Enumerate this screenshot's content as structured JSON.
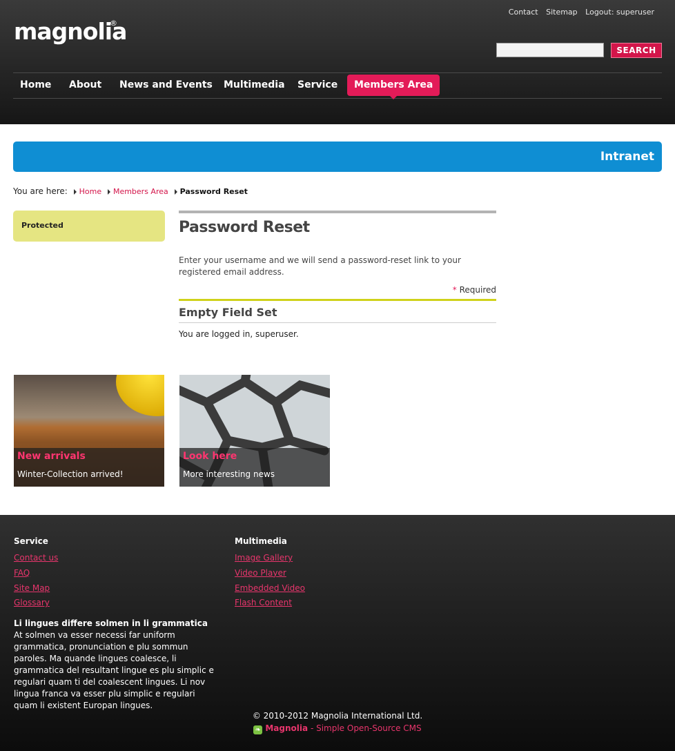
{
  "header": {
    "logo_text": "magnolia",
    "logo_reg": "®",
    "top_links": [
      "Contact",
      "Sitemap",
      "Logout: superuser"
    ],
    "search_value": "",
    "search_button": "SEARCH"
  },
  "nav": {
    "items": [
      "Home",
      "About",
      "News and Events",
      "Multimedia",
      "Service",
      "Members Area"
    ],
    "active": "Members Area"
  },
  "intranet_label": "Intranet",
  "breadcrumb": {
    "prefix": "You are here:",
    "links": [
      "Home",
      "Members Area"
    ],
    "current": "Password Reset"
  },
  "sidebar": {
    "protected_label": "Protected"
  },
  "main": {
    "title": "Password Reset",
    "intro": "Enter your username and we will send a password-reset link to your registered email address.",
    "required_star": "*",
    "required_label": "Required",
    "fieldset_title": "Empty Field Set",
    "logged_in_text": "You are logged in, superuser."
  },
  "teasers": [
    {
      "title": "New arrivals",
      "text": "Winter-Collection arrived!"
    },
    {
      "title": "Look here",
      "text": "More interesting news"
    }
  ],
  "footer": {
    "service": {
      "title": "Service",
      "links": [
        "Contact us",
        "FAQ",
        "Site Map",
        "Glossary"
      ]
    },
    "multimedia": {
      "title": "Multimedia",
      "links": [
        "Image Gallery",
        "Video Player",
        "Embedded Video",
        "Flash Content"
      ]
    },
    "about_title": "Li lingues differe solmen in li grammatica",
    "about_text": "At solmen va esser necessi far uniform grammatica, pronunciation e plu sommun paroles. Ma quande lingues coalesce, li grammatica del resultant lingue es plu simplic e regulari quam ti del coalescent lingues. Li nov lingua franca va esser plu simplic e regulari quam li existent Europan lingues.",
    "copyright": "© 2010-2012 Magnolia International Ltd.",
    "credit_brand": "Magnolia",
    "credit_tagline": "- Simple Open-Source CMS"
  },
  "colors": {
    "accent_pink": "#e31b58",
    "intranet_blue": "#0f8ed3",
    "protected_yellow": "#e5e582",
    "fieldset_green": "#cfd21a"
  },
  "icons": [
    "breadcrumb-arrow-icon",
    "magnolia-credit-icon"
  ]
}
